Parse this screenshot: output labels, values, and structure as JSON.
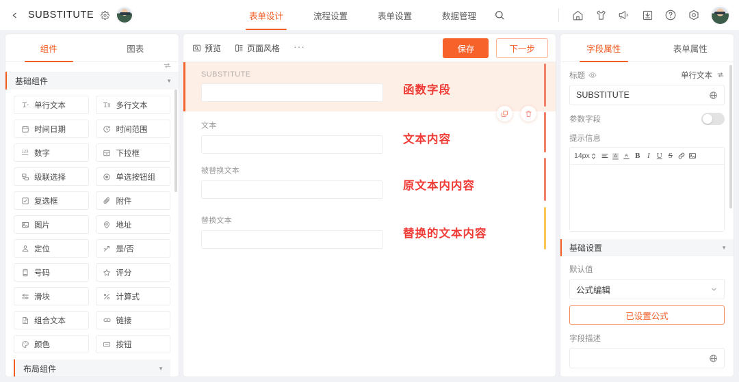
{
  "topbar": {
    "back_icon": "chevron-left-icon",
    "title": "SUBSTITUTE",
    "gear_icon": "gear-icon",
    "nav_tabs": [
      {
        "label": "表单设计",
        "active": true
      },
      {
        "label": "流程设置",
        "active": false
      },
      {
        "label": "表单设置",
        "active": false
      },
      {
        "label": "数据管理",
        "active": false
      }
    ],
    "search_icon": "search-icon",
    "right_icons": [
      "home-icon",
      "shirt-icon",
      "megaphone-icon",
      "download-icon",
      "help-icon",
      "settings-circle-icon"
    ],
    "avatar": "user-avatar"
  },
  "left_panel": {
    "tabs": [
      {
        "label": "组件",
        "active": true
      },
      {
        "label": "图表",
        "active": false
      }
    ],
    "sort_icon": "sort-icon",
    "group_title": "基础组件",
    "group_caret": "caret-down-icon",
    "components": [
      {
        "label": "单行文本",
        "icon": "single-line-text-icon"
      },
      {
        "label": "多行文本",
        "icon": "multi-line-text-icon"
      },
      {
        "label": "时间日期",
        "icon": "calendar-icon"
      },
      {
        "label": "时间范围",
        "icon": "clock-icon"
      },
      {
        "label": "数字",
        "icon": "number-icon"
      },
      {
        "label": "下拉框",
        "icon": "dropdown-icon"
      },
      {
        "label": "级联选择",
        "icon": "cascader-icon"
      },
      {
        "label": "单选按钮组",
        "icon": "radio-icon"
      },
      {
        "label": "复选框",
        "icon": "checkbox-icon"
      },
      {
        "label": "附件",
        "icon": "paperclip-icon"
      },
      {
        "label": "图片",
        "icon": "image-icon"
      },
      {
        "label": "地址",
        "icon": "location-pin-icon"
      },
      {
        "label": "定位",
        "icon": "positioning-icon"
      },
      {
        "label": "是/否",
        "icon": "boolean-icon"
      },
      {
        "label": "号码",
        "icon": "phone-number-icon"
      },
      {
        "label": "评分",
        "icon": "star-icon"
      },
      {
        "label": "滑块",
        "icon": "slider-icon"
      },
      {
        "label": "计算式",
        "icon": "formula-icon"
      },
      {
        "label": "组合文本",
        "icon": "composite-text-icon"
      },
      {
        "label": "链接",
        "icon": "link-icon"
      },
      {
        "label": "颜色",
        "icon": "color-palette-icon"
      },
      {
        "label": "按钮",
        "icon": "button-icon"
      }
    ],
    "layout_group_title": "布局组件",
    "layout_group_caret": "caret-down-icon"
  },
  "center_panel": {
    "toolbar": {
      "preview_label": "预览",
      "preview_icon": "preview-icon",
      "page_style_label": "页面风格",
      "page_style_icon": "layout-icon",
      "more_label": "···",
      "save_label": "保存",
      "next_label": "下一步"
    },
    "fields": [
      {
        "label": "SUBSTITUTE",
        "value": "",
        "selected": true,
        "annotation": "函数字段",
        "bar_color": "#f2806b"
      },
      {
        "label": "文本",
        "value": "",
        "selected": false,
        "annotation": "文本内容",
        "bar_color": "#f2806b"
      },
      {
        "label": "被替换文本",
        "value": "",
        "selected": false,
        "annotation": "原文本内内容",
        "bar_color": "#f2806b"
      },
      {
        "label": "替换文本",
        "value": "",
        "selected": false,
        "annotation": "替换的文本内容",
        "bar_color": "#fbc55a"
      }
    ],
    "row_tools": {
      "copy_icon": "copy-icon",
      "delete_icon": "trash-icon"
    }
  },
  "right_panel": {
    "tabs": [
      {
        "label": "字段属性",
        "active": true
      },
      {
        "label": "表单属性",
        "active": false
      }
    ],
    "title_label": "标题",
    "title_eye_icon": "eye-icon",
    "field_type": "单行文本",
    "field_type_icon": "swap-icon",
    "title_value": "SUBSTITUTE",
    "title_globe_icon": "globe-icon",
    "param_field_label": "参数字段",
    "param_field_on": false,
    "hint_label": "提示信息",
    "editor": {
      "font_size": "14px",
      "size_stepper_icon": "stepper-icon",
      "buttons": [
        {
          "icon": "align-icon",
          "glyph": "≡"
        },
        {
          "icon": "highlight-icon",
          "glyph": "A"
        },
        {
          "icon": "font-color-icon",
          "glyph": "A"
        },
        {
          "icon": "bold-icon",
          "glyph": "B"
        },
        {
          "icon": "italic-icon",
          "glyph": "I"
        },
        {
          "icon": "underline-icon",
          "glyph": "U"
        },
        {
          "icon": "strikethrough-icon",
          "glyph": "S"
        },
        {
          "icon": "link-icon",
          "glyph": "%"
        },
        {
          "icon": "image-icon",
          "glyph": "▧"
        }
      ],
      "content": ""
    },
    "basic_section": {
      "title": "基础设置",
      "caret": "caret-down-icon",
      "default_value_label": "默认值",
      "default_value_selected": "公式编辑",
      "default_value_chevron": "chevron-down-icon",
      "formula_button_label": "已设置公式",
      "field_desc_label": "字段描述",
      "field_desc_value": "",
      "field_desc_globe_icon": "globe-icon"
    }
  },
  "colors": {
    "accent": "#f25c22",
    "save_button": "#f7622a",
    "annotation_red": "#ef3b35",
    "selected_row_bg": "#fdeee6",
    "bar_coral": "#f2806b",
    "bar_yellow": "#fbc55a"
  }
}
